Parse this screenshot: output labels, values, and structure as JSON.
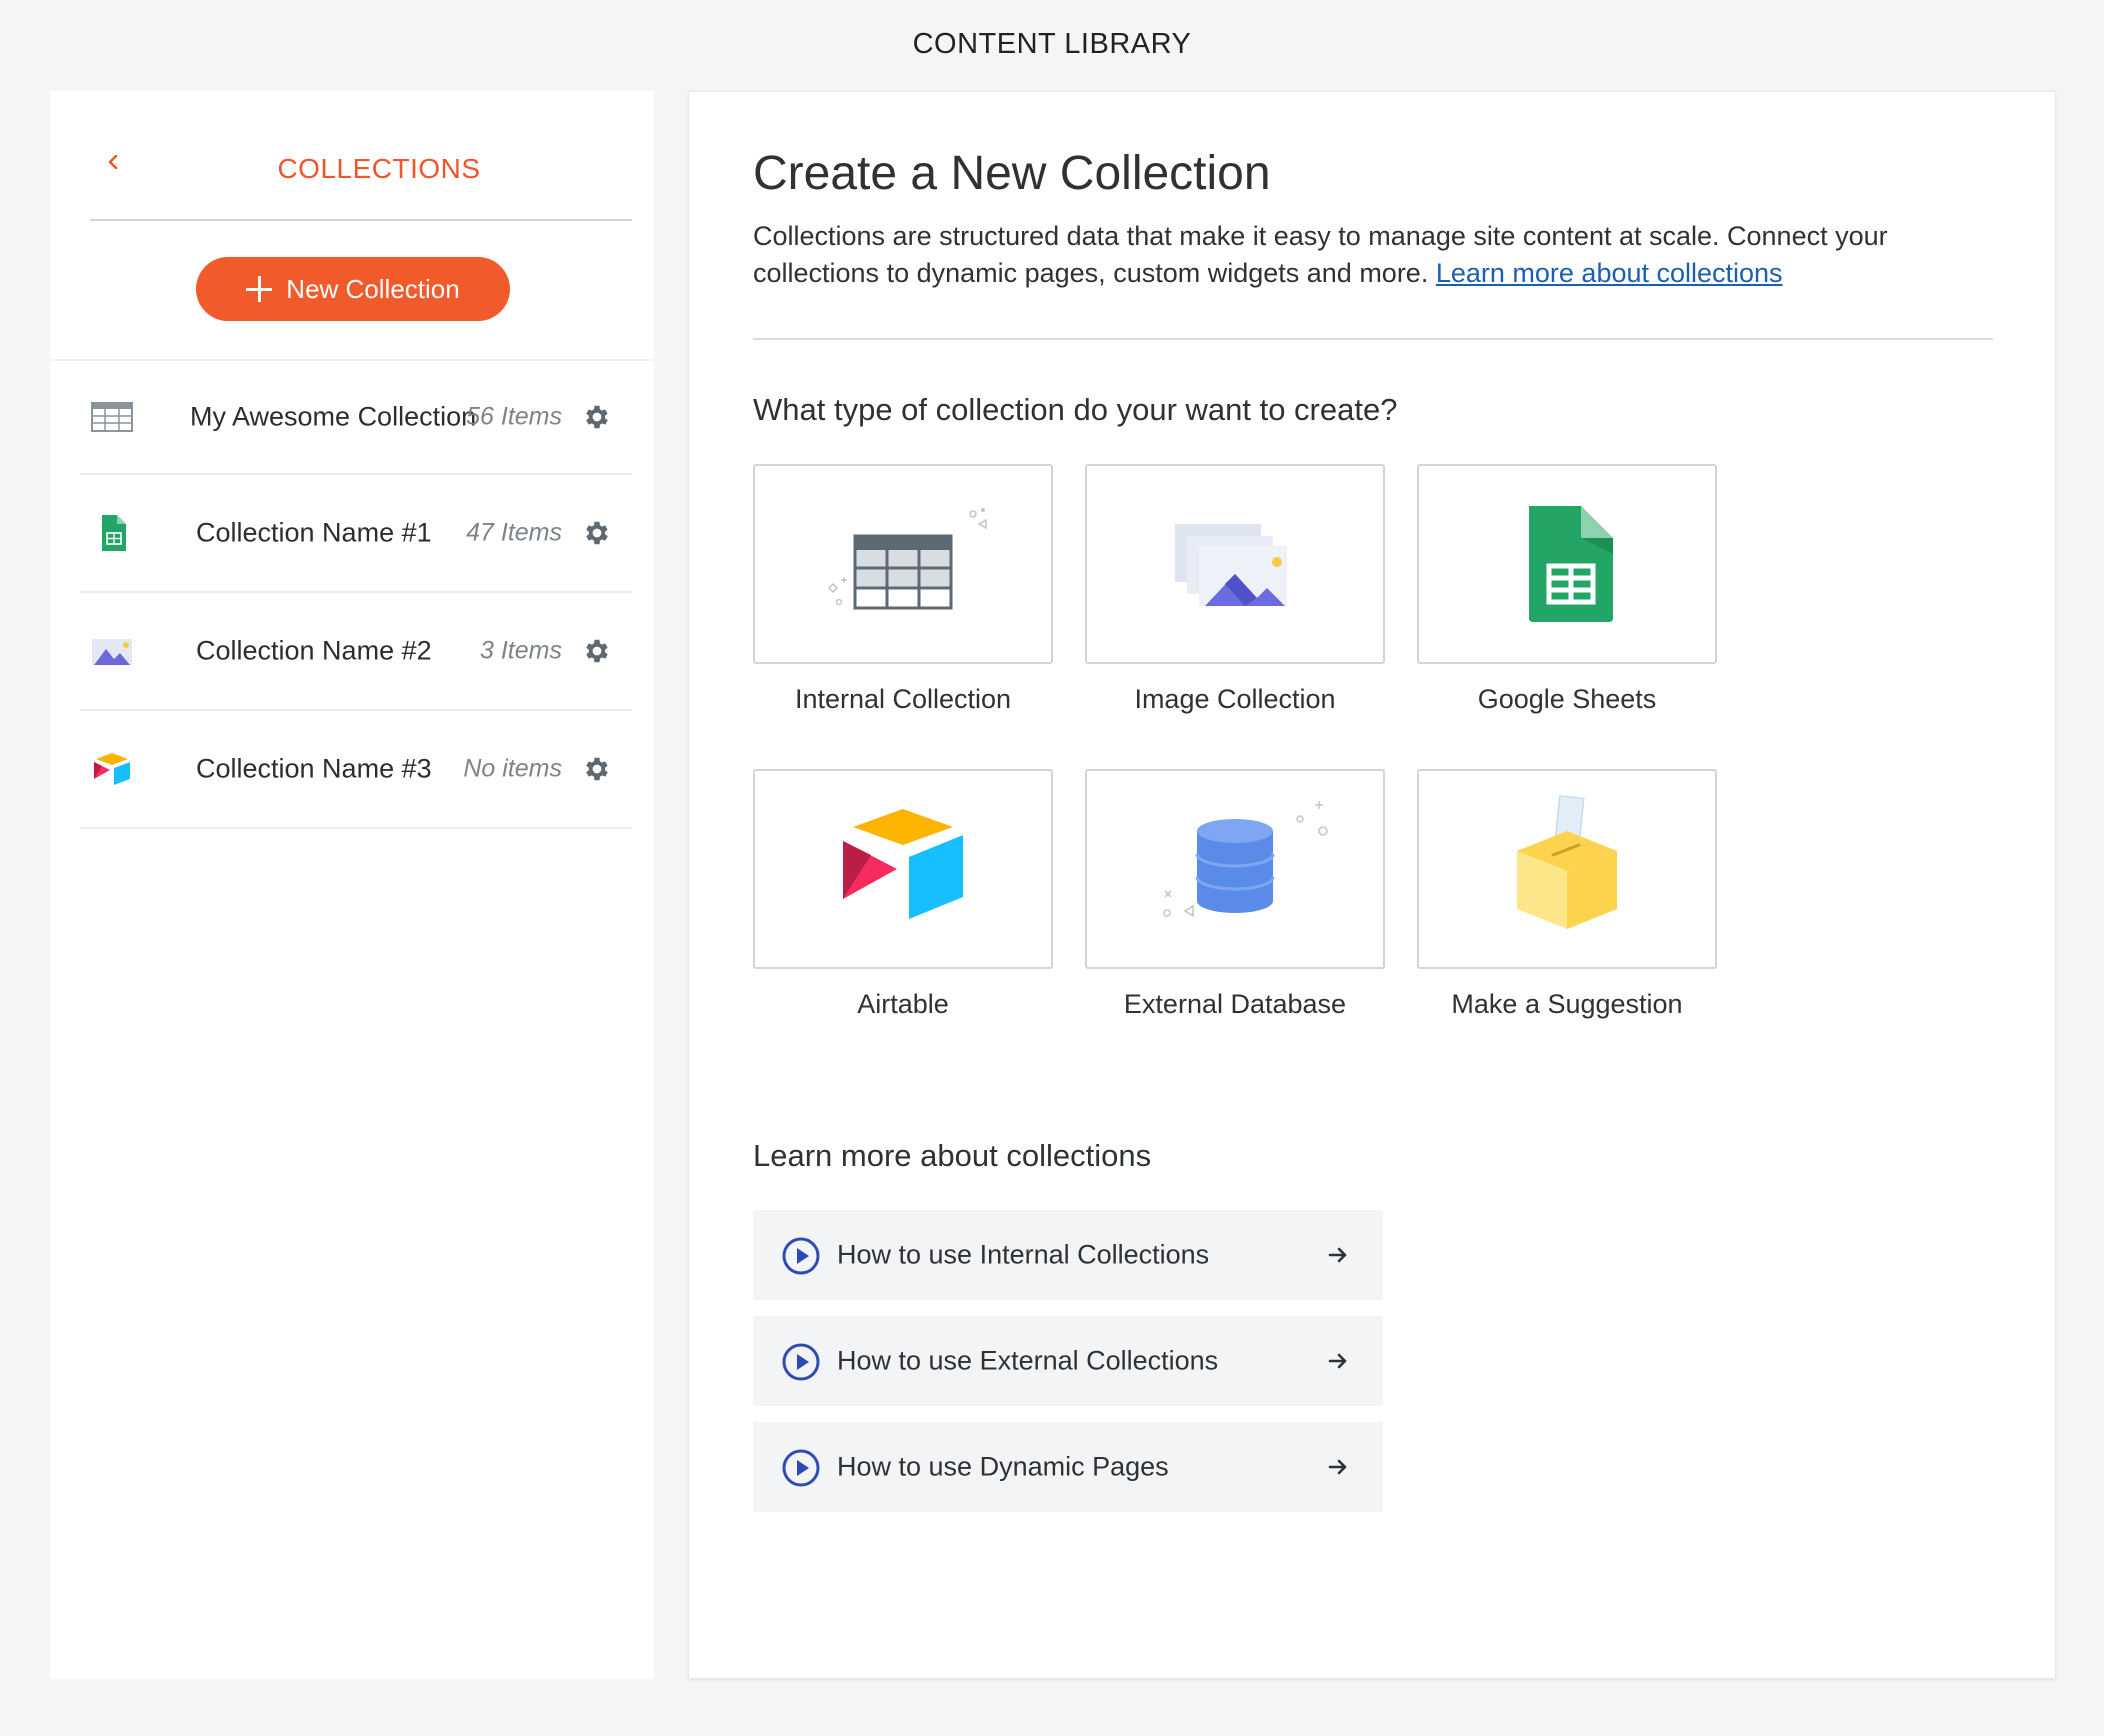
{
  "app": {
    "title": "CONTENT LIBRARY"
  },
  "sidebar": {
    "title": "COLLECTIONS",
    "new_button_label": "New Collection",
    "collections": [
      {
        "name": "My Awesome Collection",
        "count": "56 Items",
        "icon": "table-icon"
      },
      {
        "name": "Collection Name #1",
        "count": "47 Items",
        "icon": "google-sheets-icon"
      },
      {
        "name": "Collection Name #2",
        "count": "3 Items",
        "icon": "image-icon"
      },
      {
        "name": "Collection Name #3",
        "count": "No items",
        "icon": "airtable-icon"
      }
    ]
  },
  "main": {
    "title": "Create a New Collection",
    "intro_text": "Collections are structured data that make it easy to manage site content at scale. Connect your collections to dynamic pages, custom widgets and more.",
    "intro_link": "Learn more about collections",
    "types_heading": "What type of collection do your want to create?",
    "types": [
      {
        "label": "Internal Collection",
        "icon": "table-illustration-icon"
      },
      {
        "label": "Image Collection",
        "icon": "image-stack-icon"
      },
      {
        "label": "Google Sheets",
        "icon": "google-sheets-icon"
      },
      {
        "label": "Airtable",
        "icon": "airtable-icon"
      },
      {
        "label": "External Database",
        "icon": "database-icon"
      },
      {
        "label": "Make a Suggestion",
        "icon": "suggestion-box-icon"
      }
    ],
    "learn_heading": "Learn more about collections",
    "learn_items": [
      {
        "label": "How to use Internal Collections"
      },
      {
        "label": "How to use External Collections"
      },
      {
        "label": "How to use Dynamic Pages"
      }
    ]
  },
  "colors": {
    "accent": "#f15a2b",
    "link": "#1a5fb4",
    "sheets_green": "#23a566",
    "airtable_yellow": "#fcb400",
    "airtable_red": "#f82b60",
    "airtable_blue": "#2d7ff9",
    "play_blue": "#2f4bb3"
  }
}
